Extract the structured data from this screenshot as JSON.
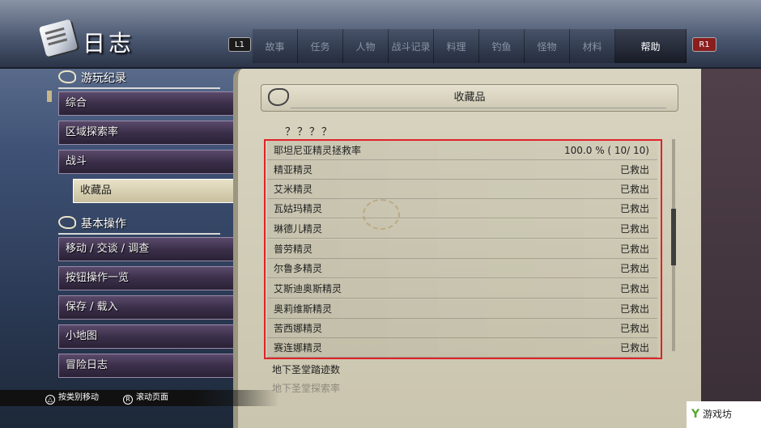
{
  "app": {
    "title": "日志"
  },
  "shoulder": {
    "left": "L1",
    "right": "R1"
  },
  "tabs": [
    {
      "label": "故事",
      "active": false
    },
    {
      "label": "任务",
      "active": false
    },
    {
      "label": "人物",
      "active": false
    },
    {
      "label": "战斗记录",
      "active": false
    },
    {
      "label": "料理",
      "active": false
    },
    {
      "label": "钓鱼",
      "active": false
    },
    {
      "label": "怪物",
      "active": false
    },
    {
      "label": "材料",
      "active": false
    },
    {
      "label": "帮助",
      "active": true
    }
  ],
  "sidebar": {
    "section1": {
      "label": "游玩纪录"
    },
    "section1_items": [
      {
        "label": "综合"
      },
      {
        "label": "区域探索率"
      },
      {
        "label": "战斗"
      },
      {
        "label": "收藏品",
        "selected": true
      }
    ],
    "section2": {
      "label": "基本操作"
    },
    "section2_items": [
      {
        "label": "移动 / 交谈 / 调查"
      },
      {
        "label": "按钮操作一览"
      },
      {
        "label": "保存 / 载入"
      },
      {
        "label": "小地图"
      },
      {
        "label": "冒险日志"
      }
    ]
  },
  "panel": {
    "header": "收藏品",
    "unknown": "？？？？",
    "rows": [
      {
        "name": "耶坦尼亚精灵拯救率",
        "value": "100.0 % (      10/      10)"
      },
      {
        "name": "精亚精灵",
        "value": "已救出"
      },
      {
        "name": "艾米精灵",
        "value": "已救出"
      },
      {
        "name": "瓦姑玛精灵",
        "value": "已救出"
      },
      {
        "name": "琳德儿精灵",
        "value": "已救出"
      },
      {
        "name": "普劳精灵",
        "value": "已救出"
      },
      {
        "name": "尔鲁多精灵",
        "value": "已救出"
      },
      {
        "name": "艾斯迪奥斯精灵",
        "value": "已救出"
      },
      {
        "name": "奥莉维斯精灵",
        "value": "已救出"
      },
      {
        "name": "苦西娜精灵",
        "value": "已救出"
      },
      {
        "name": "赛连娜精灵",
        "value": "已救出"
      }
    ],
    "after_row": "地下圣堂踏迹数",
    "after_row_faded": "地下圣堂探索率"
  },
  "footer": {
    "hint1": "按类别移动",
    "hint2": "滚动页面"
  },
  "watermark": {
    "text": "游戏坊"
  }
}
